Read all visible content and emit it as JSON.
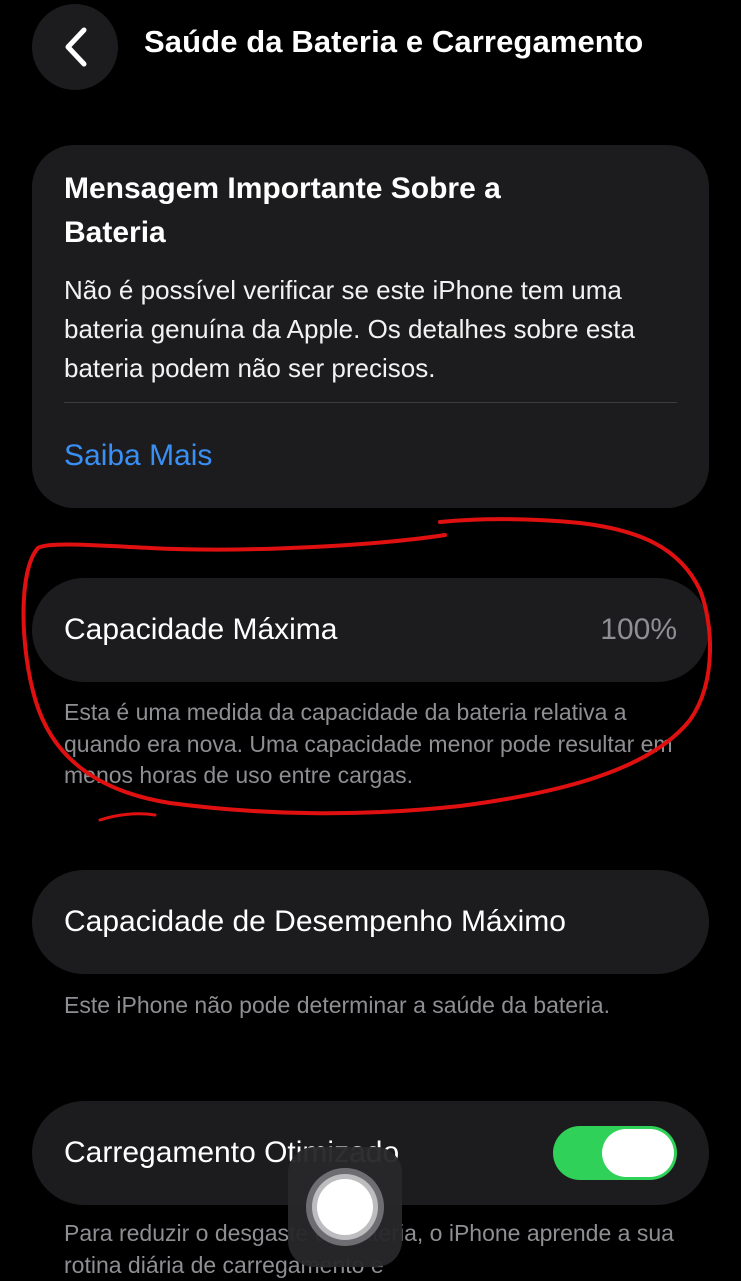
{
  "nav": {
    "back_icon": "chevron-left-icon",
    "title": "Saúde da Bateria e Carregamento"
  },
  "alert": {
    "title": "Mensagem Importante Sobre a Bateria",
    "body": "Não é possível verificar se este iPhone tem uma bateria genuína da Apple. Os detalhes sobre esta bateria podem não ser precisos.",
    "link": "Saiba Mais"
  },
  "capacity": {
    "label": "Capacidade Máxima",
    "value": "100%",
    "footnote": "Esta é uma medida da capacidade da bateria relativa a quando era nova. Uma capacidade menor pode resultar em menos horas de uso entre cargas."
  },
  "performance": {
    "label": "Capacidade de Desempenho Máximo",
    "footnote": "Este iPhone não pode determinar a saúde da bateria."
  },
  "optimized": {
    "label": "Carregamento Otimizado",
    "enabled": true,
    "footnote": "Para reduzir o desgaste da bateria, o iPhone aprende a sua rotina diária de carregamento e"
  },
  "colors": {
    "background": "#000000",
    "card": "#1c1c1e",
    "link": "#3a8ff5",
    "toggle_on": "#30d158",
    "annotation": "#e01010"
  }
}
